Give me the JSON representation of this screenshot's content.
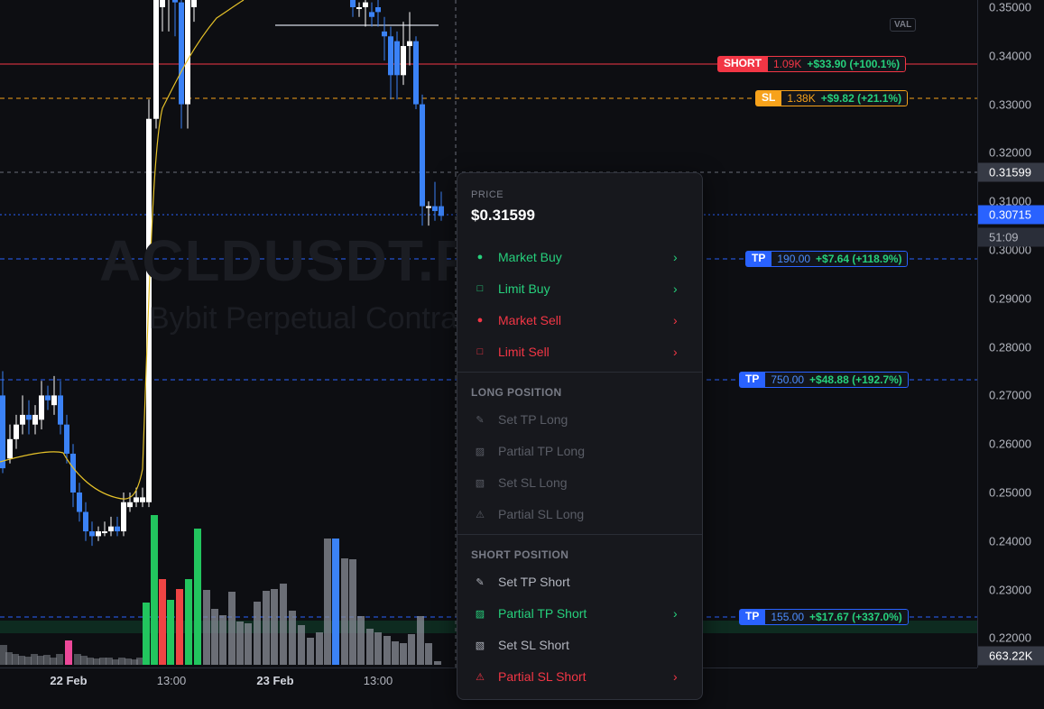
{
  "chart": {
    "symbol_watermark": "ACLDUSDT.P,",
    "description_watermark": "Bybit Perpetual Contra",
    "val_tag": "VAL",
    "price_ticks": [
      "0.35000",
      "0.34000",
      "0.33000",
      "0.32000",
      "0.31000",
      "0.30000",
      "0.29000",
      "0.28000",
      "0.27000",
      "0.26000",
      "0.25000",
      "0.24000",
      "0.23000",
      "0.22000"
    ],
    "crosshair_price": "0.31599",
    "last_price": "0.30715",
    "countdown": "51:09",
    "volume_badge": "663.22K",
    "time_ticks": [
      {
        "label": "22 Feb",
        "bold": true
      },
      {
        "label": "13:00",
        "bold": false
      },
      {
        "label": "23 Feb",
        "bold": true
      },
      {
        "label": "13:00",
        "bold": false
      }
    ],
    "colors": {
      "up": "#ffffff",
      "down": "#3b82f6",
      "vol_up": "#22c55e",
      "vol_down": "#ef4444",
      "vol_neutral": "#9ca3af",
      "ma": "#e6c229"
    }
  },
  "orders": [
    {
      "kind": "SHORT",
      "qty": "1.09K",
      "pnl": "+$33.90 (+100.1%)",
      "style": "short"
    },
    {
      "kind": "SL",
      "qty": "1.38K",
      "pnl": "+$9.82 (+21.1%)",
      "style": "sl"
    },
    {
      "kind": "TP",
      "qty": "190.00",
      "pnl": "+$7.64 (+118.9%)",
      "style": "tp"
    },
    {
      "kind": "TP",
      "qty": "750.00",
      "pnl": "+$48.88 (+192.7%)",
      "style": "tp"
    },
    {
      "kind": "TP",
      "qty": "155.00",
      "pnl": "+$17.67 (+337.0%)",
      "style": "tp"
    }
  ],
  "menu": {
    "price_label": "PRICE",
    "price_value": "$0.31599",
    "order_items": [
      {
        "label": "Market Buy",
        "icon": "●",
        "icon_name": "dot-icon",
        "color": "green",
        "chevron": true
      },
      {
        "label": "Limit Buy",
        "icon": "□",
        "icon_name": "square-icon",
        "color": "green",
        "chevron": true
      },
      {
        "label": "Market Sell",
        "icon": "●",
        "icon_name": "dot-icon",
        "color": "red",
        "chevron": true
      },
      {
        "label": "Limit Sell",
        "icon": "□",
        "icon_name": "square-icon",
        "color": "red",
        "chevron": true
      }
    ],
    "long_section": "LONG POSITION",
    "long_items": [
      {
        "label": "Set TP Long",
        "icon": "✎",
        "icon_name": "pencil-icon",
        "color": "disabled",
        "chevron": false
      },
      {
        "label": "Partial TP Long",
        "icon": "▨",
        "icon_name": "hatched-square-icon",
        "color": "disabled",
        "chevron": false
      },
      {
        "label": "Set SL Long",
        "icon": "▧",
        "icon_name": "shield-square-icon",
        "color": "disabled",
        "chevron": false
      },
      {
        "label": "Partial SL Long",
        "icon": "⚠",
        "icon_name": "warning-icon",
        "color": "disabled",
        "chevron": false
      }
    ],
    "short_section": "SHORT POSITION",
    "short_items": [
      {
        "label": "Set TP Short",
        "icon": "✎",
        "icon_name": "pencil-icon",
        "color": "neutral",
        "chevron": false
      },
      {
        "label": "Partial TP Short",
        "icon": "▨",
        "icon_name": "hatched-square-icon",
        "color": "green",
        "chevron": true
      },
      {
        "label": "Set SL Short",
        "icon": "▧",
        "icon_name": "shield-square-icon",
        "color": "neutral",
        "chevron": false
      },
      {
        "label": "Partial SL Short",
        "icon": "⚠",
        "icon_name": "warning-icon",
        "color": "red",
        "chevron": true
      }
    ],
    "chevron": "›"
  }
}
